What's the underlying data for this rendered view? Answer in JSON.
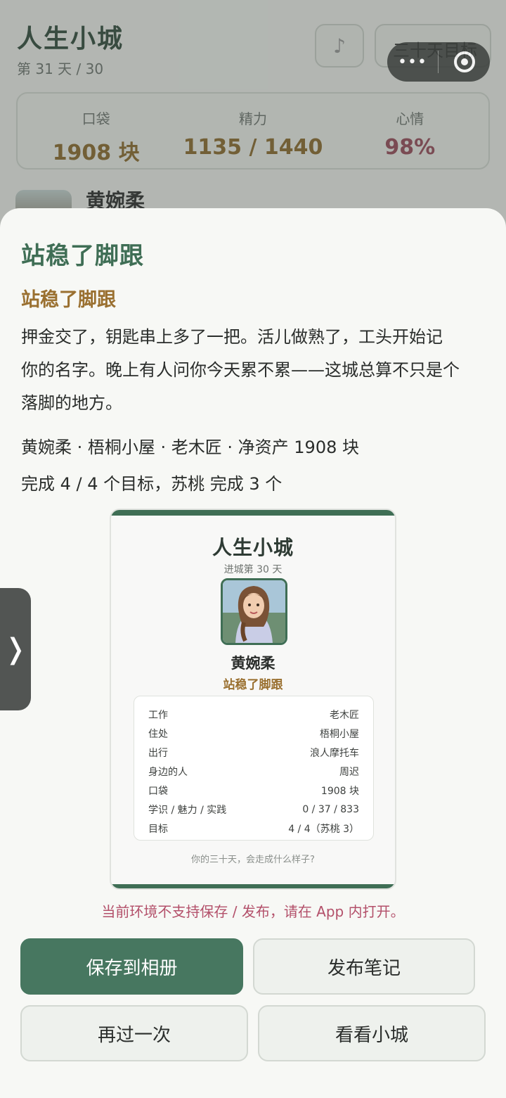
{
  "app": {
    "title": "人生小城",
    "day": "第 31 天 / 30",
    "goal_button": "三十天目标",
    "capsule_dots": "•••"
  },
  "stats": {
    "pocket": {
      "label": "口袋",
      "value": "1908 块"
    },
    "energy": {
      "label": "精力",
      "value": "1135 / 1440"
    },
    "mood": {
      "label": "心情",
      "value": "98%"
    }
  },
  "profile": {
    "name": "黄婉柔"
  },
  "sheet": {
    "title": "站稳了脚跟",
    "subtitle": "站稳了脚跟",
    "body_lines": [
      "押金交了，钥匙串上多了一把。活儿做熟了，工头开始记",
      "你的名字。晚上有人问你今天累不累——这城总算不只是个",
      "落脚的地方。"
    ],
    "summary": "黄婉柔 · 梧桐小屋 · 老木匠 · 净资产 1908 块",
    "progress": "完成 4 / 4 个目标，苏桃 完成 3 个",
    "side_handle": "❭"
  },
  "card": {
    "title": "人生小城",
    "day": "进城第 30 天",
    "name": "黄婉柔",
    "subtitle": "站稳了脚跟",
    "rows": [
      {
        "label": "工作",
        "value": "老木匠"
      },
      {
        "label": "住处",
        "value": "梧桐小屋"
      },
      {
        "label": "出行",
        "value": "浪人摩托车"
      },
      {
        "label": "身边的人",
        "value": "周迟"
      },
      {
        "label": "口袋",
        "value": "1908 块"
      },
      {
        "label": "学识 / 魅力 / 实践",
        "value": "0 / 37 / 833"
      },
      {
        "label": "目标",
        "value": "4 / 4（苏桃 3）"
      }
    ],
    "footer": "你的三十天，会走成什么样子?"
  },
  "warning": "当前环境不支持保存 / 发布，请在 App 内打开。",
  "buttons": {
    "save": "保存到相册",
    "post": "发布笔记",
    "again": "再过一次",
    "city": "看看小城"
  },
  "colors": {
    "accent": "#477760",
    "gold": "#9a7030",
    "warning": "#b3506a"
  }
}
